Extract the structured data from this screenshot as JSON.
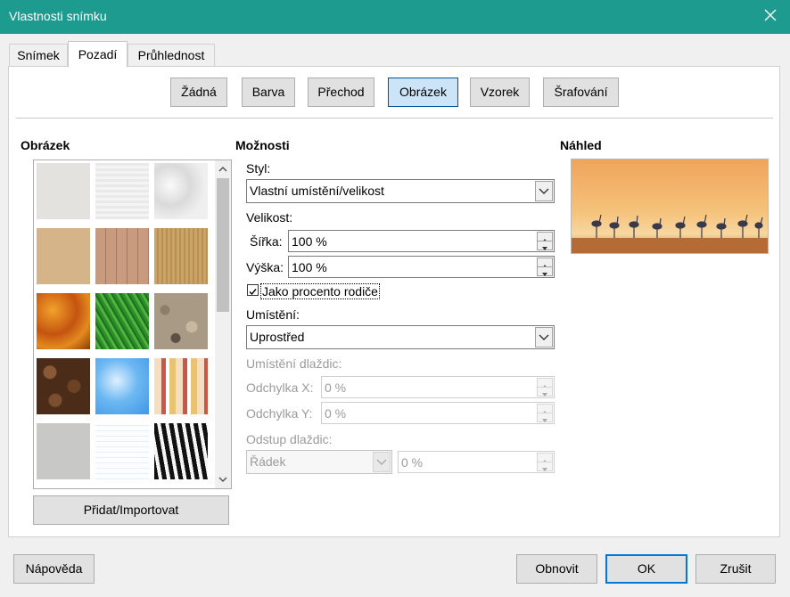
{
  "window": {
    "title": "Vlastnosti snímku"
  },
  "tabs": [
    {
      "label": "Snímek"
    },
    {
      "label": "Pozadí"
    },
    {
      "label": "Průhlednost"
    }
  ],
  "fill_buttons": [
    {
      "label": "Žádná"
    },
    {
      "label": "Barva"
    },
    {
      "label": "Přechod"
    },
    {
      "label": "Obrázek"
    },
    {
      "label": "Vzorek"
    },
    {
      "label": "Šrafování"
    }
  ],
  "image_section": {
    "heading": "Obrázek",
    "thumbnails": [
      "painted-white",
      "paper-texture",
      "paper-crumpled",
      "parchment-paper",
      "fence",
      "wooden-board",
      "maple-leaves",
      "lawn",
      "pebble-light",
      "coffee-beans",
      "clouds",
      "color-stripes",
      "concrete",
      "graph-paper",
      "zebra"
    ],
    "import_button": "Přidat/Importovat"
  },
  "options": {
    "heading": "Možnosti",
    "style_label": "Styl:",
    "style_value": "Vlastní umístění/velikost",
    "size_label": "Velikost:",
    "width_label": "Šířka:",
    "width_value": "100 %",
    "height_label": "Výška:",
    "height_value": "100 %",
    "relative_label": "Jako procento rodiče",
    "relative_checked": true,
    "position_label": "Umístění:",
    "position_value": "Uprostřed",
    "tile_position_label": "Umístění dlaždic:",
    "offset_x_label": "Odchylka X:",
    "offset_x_value": "0 %",
    "offset_y_label": "Odchylka Y:",
    "offset_y_value": "0 %",
    "tile_offset_label": "Odstup dlaždic:",
    "tile_offset_mode": "Řádek",
    "tile_offset_value": "0 %"
  },
  "preview": {
    "heading": "Náhled"
  },
  "footer": {
    "help": "Nápověda",
    "reset": "Obnovit",
    "ok": "OK",
    "cancel": "Zrušit"
  },
  "colors": {
    "titlebar": "#1e9b8f",
    "selected_button": "#cce4f7",
    "primary_border": "#0078d7"
  }
}
